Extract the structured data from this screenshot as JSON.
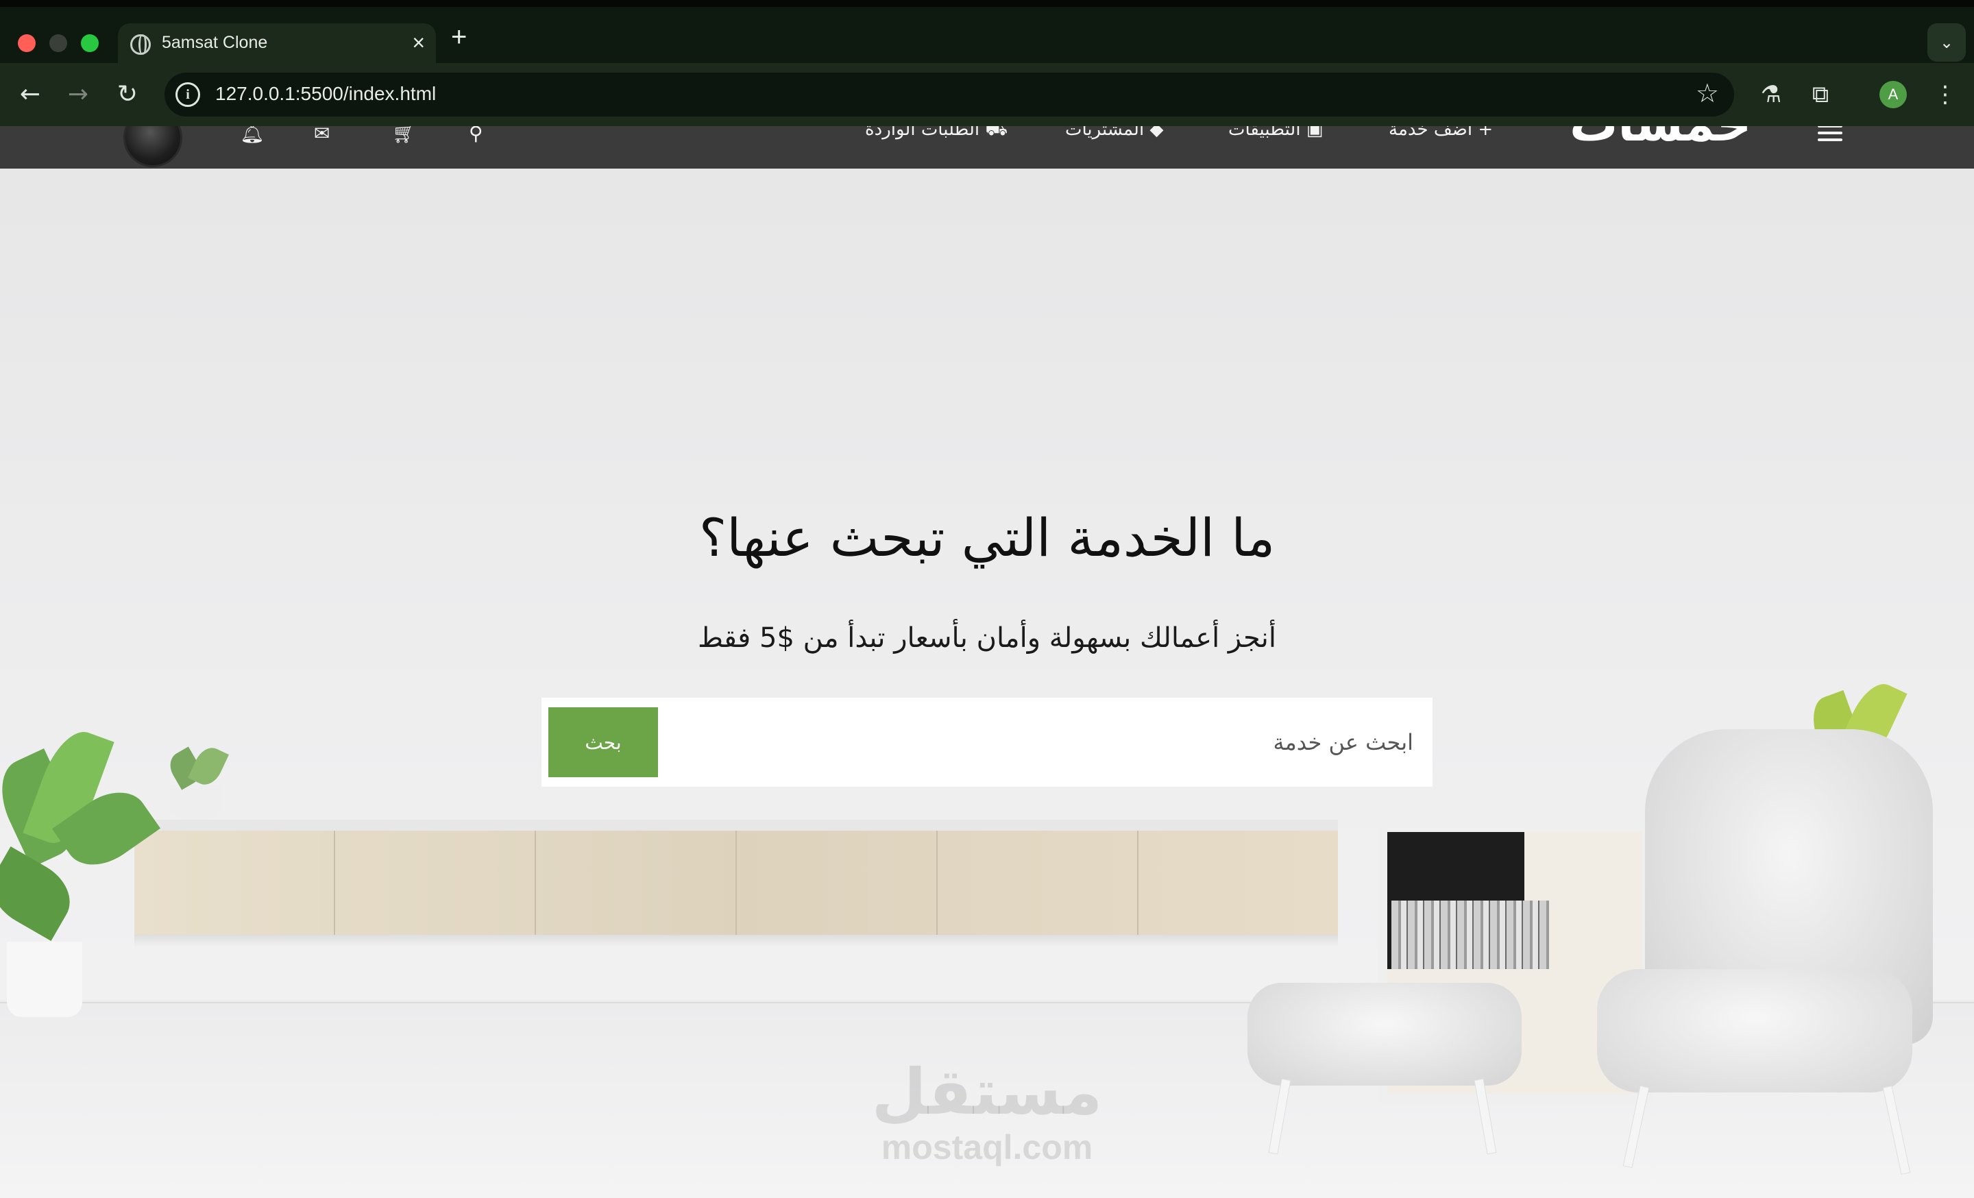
{
  "browser": {
    "tab_title": "5amsat Clone",
    "tab_close": "×",
    "new_tab": "+",
    "url": "127.0.0.1:5500/index.html",
    "profile_initial": "A",
    "icons": [
      "back-icon",
      "forward-icon",
      "reload-icon",
      "info-icon",
      "star-icon",
      "labs-icon",
      "extensions-icon",
      "more-icon"
    ]
  },
  "site_nav": {
    "brand": "خمسات",
    "links": {
      "orders": "الطلبات الواردة",
      "purchases": "المشتريات",
      "apps": "التطبيقات",
      "add_service": "أضف خدمة"
    },
    "icons": [
      "avatar",
      "bell-icon",
      "mail-icon",
      "cart-icon",
      "search-icon",
      "truck-icon",
      "tag-icon",
      "apps-icon",
      "plus-icon",
      "menu-icon"
    ]
  },
  "hero": {
    "title": "ما الخدمة التي تبحث عنها؟",
    "subtitle": "أنجز أعمالك بسهولة وأمان بأسعار تبدأ من $5 فقط",
    "search_placeholder": "ابحث عن خدمة",
    "search_button": "بحث"
  },
  "watermark": {
    "arabic": "مستقل",
    "latin": "mostaql.com"
  },
  "colors": {
    "nav_bg": "#3b3b3b",
    "accent_green": "#6ca548",
    "brand_gold": "#c9a227"
  }
}
